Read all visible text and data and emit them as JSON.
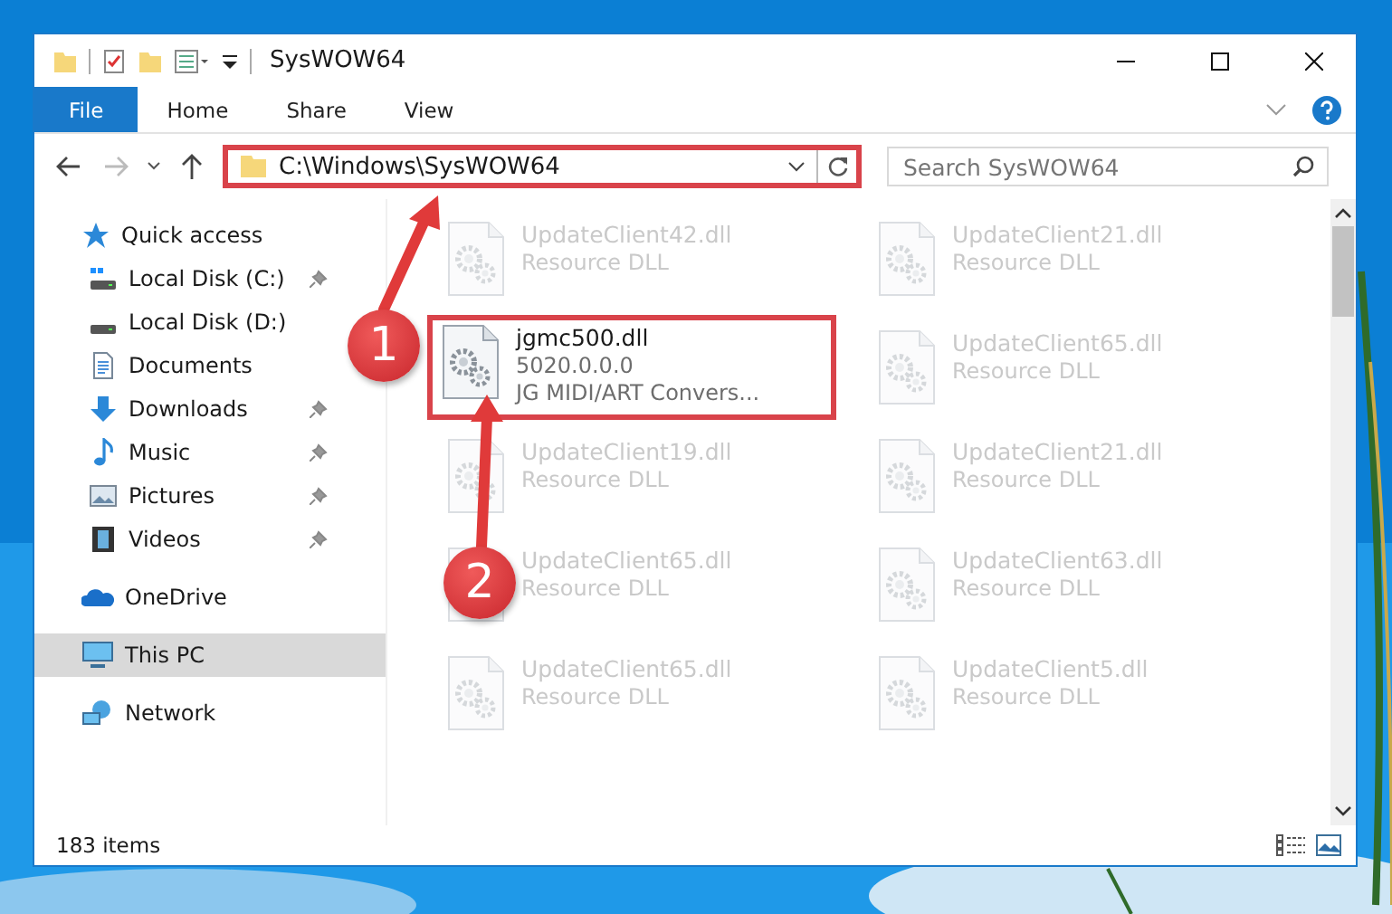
{
  "window": {
    "title": "SysWOW64"
  },
  "ribbon_tabs": [
    {
      "label": "File",
      "kind": "file"
    },
    {
      "label": "Home",
      "kind": "tab"
    },
    {
      "label": "Share",
      "kind": "tab"
    },
    {
      "label": "View",
      "kind": "tab"
    }
  ],
  "address": {
    "path": "C:\\Windows\\SysWOW64",
    "highlighted": true
  },
  "search": {
    "placeholder": "Search SysWOW64"
  },
  "nav": [
    {
      "label": "Quick access",
      "kind": "star",
      "selected": false,
      "children": [
        {
          "label": "Local Disk (C:)",
          "kind": "disk-c",
          "pinned": true,
          "selected": false
        },
        {
          "label": "Local Disk (D:)",
          "kind": "disk",
          "pinned": false,
          "selected": false
        },
        {
          "label": "Documents",
          "kind": "documents",
          "pinned": false,
          "selected": false
        },
        {
          "label": "Downloads",
          "kind": "downloads",
          "pinned": true,
          "selected": false
        },
        {
          "label": "Music",
          "kind": "music",
          "pinned": true,
          "selected": false
        },
        {
          "label": "Pictures",
          "kind": "pictures",
          "pinned": true,
          "selected": false
        },
        {
          "label": "Videos",
          "kind": "videos",
          "pinned": true,
          "selected": false
        }
      ]
    },
    {
      "label": "OneDrive",
      "kind": "cloud",
      "selected": false
    },
    {
      "label": "This PC",
      "kind": "pc",
      "selected": true
    },
    {
      "label": "Network",
      "kind": "network",
      "selected": false
    }
  ],
  "files": [
    {
      "name": "UpdateClient42.dll",
      "lines": [
        "Resource DLL"
      ],
      "blurred": true,
      "highlighted": false
    },
    {
      "name": "UpdateClient21.dll",
      "lines": [
        "Resource DLL"
      ],
      "blurred": true,
      "highlighted": false
    },
    {
      "name": "jgmc500.dll",
      "lines": [
        "5020.0.0.0",
        "JG MIDI/ART Convers..."
      ],
      "blurred": false,
      "highlighted": true
    },
    {
      "name": "UpdateClient65.dll",
      "lines": [
        "Resource DLL"
      ],
      "blurred": true,
      "highlighted": false
    },
    {
      "name": "UpdateClient19.dll",
      "lines": [
        "Resource DLL"
      ],
      "blurred": true,
      "highlighted": false
    },
    {
      "name": "UpdateClient21.dll",
      "lines": [
        "Resource DLL"
      ],
      "blurred": true,
      "highlighted": false
    },
    {
      "name": "UpdateClient65.dll",
      "lines": [
        "Resource DLL"
      ],
      "blurred": true,
      "highlighted": false
    },
    {
      "name": "UpdateClient63.dll",
      "lines": [
        "Resource DLL"
      ],
      "blurred": true,
      "highlighted": false
    },
    {
      "name": "UpdateClient65.dll",
      "lines": [
        "Resource DLL"
      ],
      "blurred": true,
      "highlighted": false
    },
    {
      "name": "UpdateClient5.dll",
      "lines": [
        "Resource DLL"
      ],
      "blurred": true,
      "highlighted": false
    }
  ],
  "status_bar": {
    "count": "183 items"
  },
  "annotations": [
    {
      "label": "1"
    },
    {
      "label": "2"
    }
  ]
}
